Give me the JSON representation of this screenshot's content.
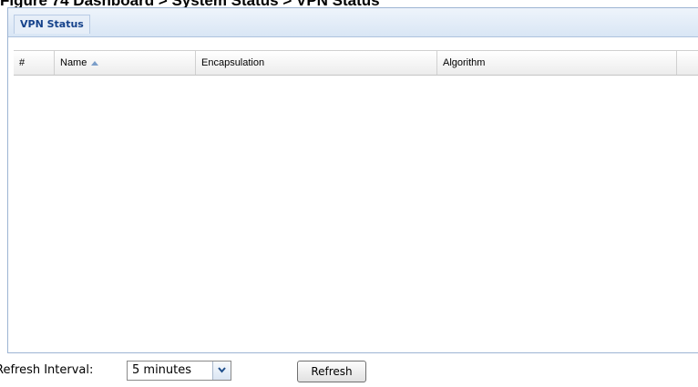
{
  "figure_caption": "Figure 74 Dashboard > System Status > VPN Status",
  "panel": {
    "title": "VPN Status"
  },
  "table": {
    "columns": [
      "#",
      "Name",
      "Encapsulation",
      "Algorithm"
    ],
    "sorted_column": "Name",
    "sort_direction": "ascending",
    "rows": []
  },
  "footer": {
    "interval_label": "Refresh Interval:",
    "interval_value": "5 minutes",
    "refresh_label": "Refresh"
  },
  "colors": {
    "title_text": "#15428b",
    "panel_border": "#9db4d3",
    "header_bg": "#d9e6f5"
  },
  "icons": [
    "sort-ascending-icon",
    "dropdown-arrow-icon"
  ]
}
